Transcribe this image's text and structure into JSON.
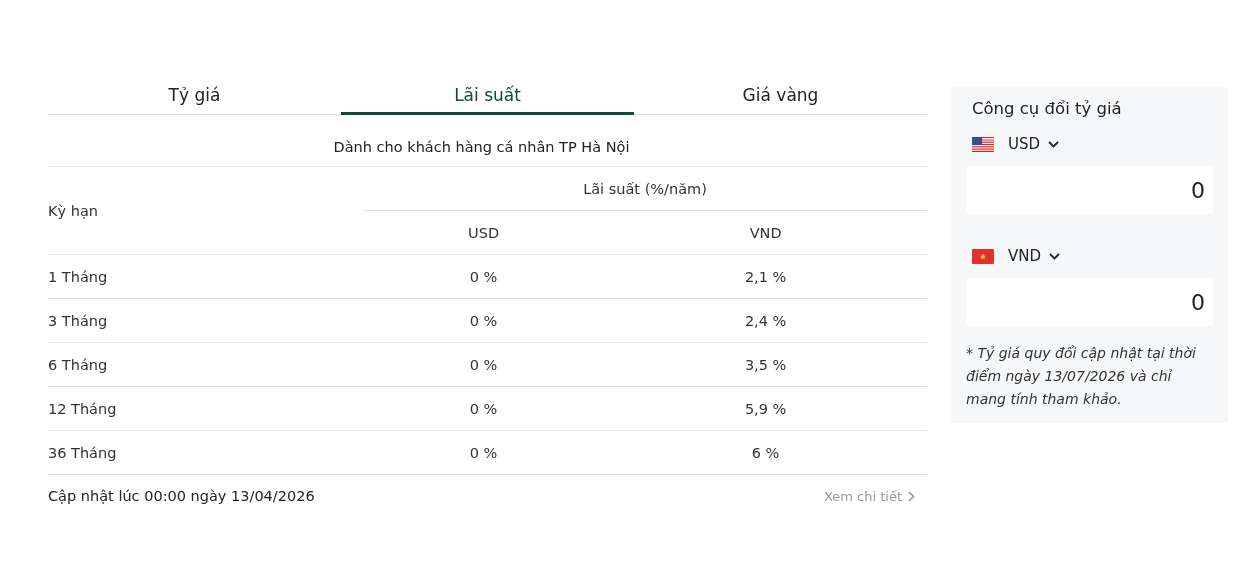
{
  "tabs": [
    {
      "label": "Tỷ giá",
      "selected": false
    },
    {
      "label": "Lãi suất",
      "selected": true
    },
    {
      "label": "Giá vàng",
      "selected": false
    }
  ],
  "subtitle": "Dành cho khách hàng cá nhân TP Hà Nội",
  "table": {
    "term_header": "Kỳ hạn",
    "group_header": "Lãi suất (%/năm)",
    "columns": [
      "USD",
      "VND"
    ],
    "rows": [
      {
        "term": "1 Tháng",
        "values": [
          "0 %",
          "2,1 %"
        ]
      },
      {
        "term": "3 Tháng",
        "values": [
          "0 %",
          "2,4 %"
        ]
      },
      {
        "term": "6 Tháng",
        "values": [
          "0 %",
          "3,5 %"
        ]
      },
      {
        "term": "12 Tháng",
        "values": [
          "0 %",
          "5,9 %"
        ]
      },
      {
        "term": "36 Tháng",
        "values": [
          "0 %",
          "6 %"
        ]
      }
    ]
  },
  "footer": {
    "updated": "Cập nhật lúc 00:00 ngày 13/04/2026",
    "link": "Xem chi tiết"
  },
  "converter": {
    "title": "Công cụ đổi tỷ giá",
    "currencies": [
      {
        "code": "USD",
        "kind": "us",
        "value": "0"
      },
      {
        "code": "VND",
        "kind": "vn",
        "value": "0"
      }
    ],
    "note": "* Tỷ giá quy đổi cập nhật tại thời điểm ngày 13/07/2026 và chỉ mang tính tham khảo."
  }
}
